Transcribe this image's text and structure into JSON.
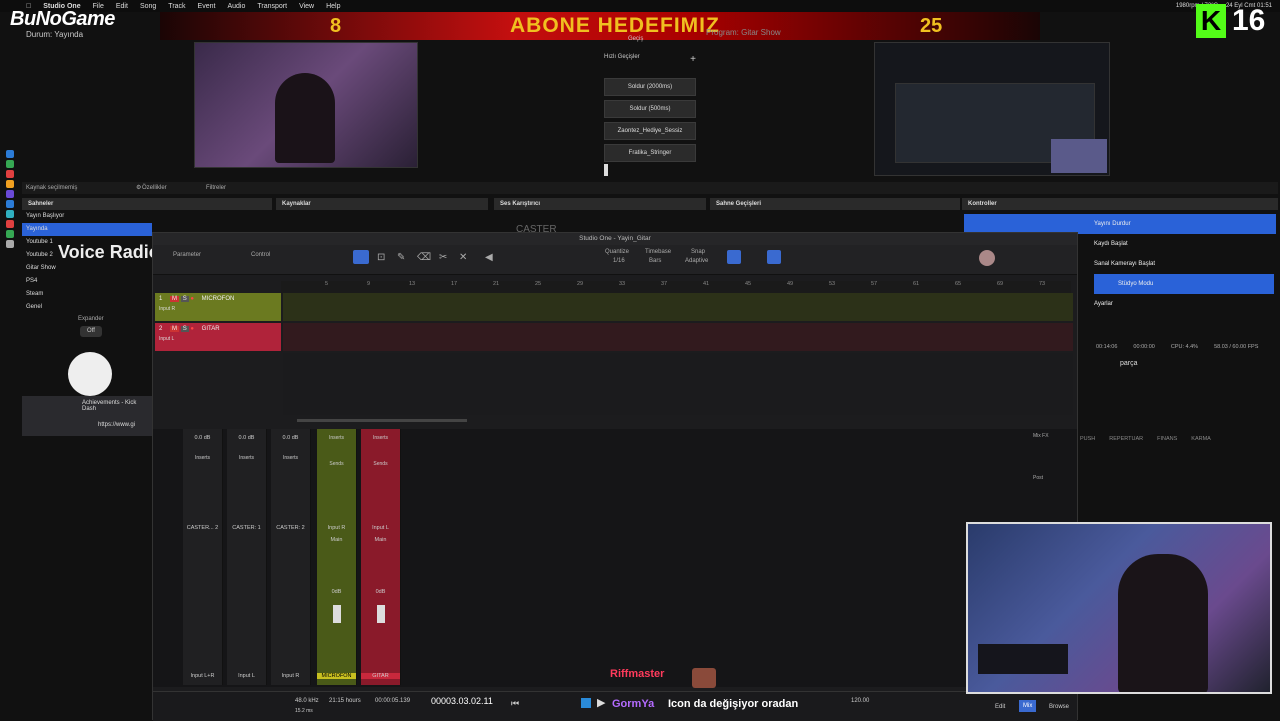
{
  "menubar": {
    "app": "Studio One",
    "items": [
      "File",
      "Edit",
      "Song",
      "Track",
      "Event",
      "Audio",
      "Transport",
      "View",
      "Help"
    ],
    "status_res": "1980rpm / 72°C",
    "date": "24 Eyl Cmt 01:51"
  },
  "logo": {
    "text": "BuNoGame",
    "sub": "Durum: Yayında"
  },
  "banner": {
    "left_num": "8",
    "title": "ABONE HEDEFIMIZ",
    "right_num": "25"
  },
  "kick": {
    "letter": "K",
    "count": "16"
  },
  "program_label": "Program: Gitar Show",
  "transitions": {
    "header": "Geçiş",
    "quick": "Hızlı Geçişler",
    "items": [
      "Soldur (2000ms)",
      "Soldur (500ms)",
      "Zaontez_Hediye_Sessiz",
      "Fratika_Stringer"
    ]
  },
  "obs": {
    "source_bar": "Kaynak seçilmemiş",
    "props": "Özellikler",
    "filters": "Filtreler",
    "docks": [
      "Sahneler",
      "Kaynaklar",
      "Ses Karıştırıcı",
      "Sahne Geçişleri",
      "Kontroller"
    ],
    "scenes": [
      "Yayın Başlıyor",
      "Yayında",
      "Youtube 1",
      "Youtube 2",
      "Gitar Show",
      "PS4",
      "Steam",
      "Genel"
    ],
    "controls": [
      "Yayını Durdur",
      "Kaydı Başlat",
      "Sanal Kamerayı Başlat",
      "Stüdyo Modu",
      "Ayarlar"
    ],
    "stats": {
      "time": "00:14:06",
      "rec": "00:00:00",
      "cpu": "CPU: 4.4%",
      "fps": "58.03 / 60.00 FPS"
    },
    "chat_text": "parça",
    "expander": "Expander",
    "off": "Off"
  },
  "voice_radio": "Voice Radio",
  "caster_label": "CASTER",
  "browser": {
    "tab": "Achievements - Kick Dash",
    "url": "https://www.gi",
    "bookmarks": [
      "PUSH",
      "REPERTUAR",
      "FINANS",
      "KARMA"
    ]
  },
  "studio": {
    "title": "Studio One - Yayin_Gitar",
    "toolbar": {
      "param": "Parameter",
      "control": "Control",
      "quantize": "Quantize",
      "q_val": "1/16",
      "timebase": "Timebase",
      "tb_val": "Bars",
      "snap": "Snap",
      "snap_val": "Adaptive"
    },
    "ruler": [
      "5",
      "9",
      "13",
      "17",
      "21",
      "25",
      "29",
      "33",
      "37",
      "41",
      "45",
      "49",
      "53",
      "57",
      "61",
      "65",
      "69",
      "73"
    ],
    "tracks": [
      {
        "num": "1",
        "name": "MICROFON",
        "input": "Input R",
        "color": "#8a9a2a"
      },
      {
        "num": "2",
        "name": "GITAR",
        "input": "Input L",
        "color": "#c8283c"
      }
    ],
    "mixer": {
      "strips": [
        {
          "name": "CASTER... 2",
          "input": "Input L+R",
          "db": "0.0 dB"
        },
        {
          "name": "CASTER: 1",
          "input": "Input L",
          "db": "0.0 dB"
        },
        {
          "name": "CASTER: 2",
          "input": "Input R",
          "db": "0.0 dB"
        },
        {
          "name": "Input R",
          "input": "MICROFON",
          "db": "0dB",
          "sub": "Main",
          "color": "#8aa32a"
        },
        {
          "name": "Input L",
          "input": "GITAR",
          "db": "0dB",
          "sub": "Main",
          "color": "#c8283c"
        }
      ],
      "inserts": "Inserts",
      "sends": "Sends",
      "post": "Post",
      "mixfx": "Mix FX"
    },
    "transport": {
      "samplerate": "48.0 kHz",
      "latency": "15.2 ms",
      "record_max": "21:15 hours",
      "seconds": "00:00:05.139",
      "bars": "00003.03.02.11",
      "tempo": "120.00",
      "tabs": [
        "Edit",
        "Mix",
        "Browse"
      ]
    }
  },
  "chat": {
    "user1": "Riffmaster",
    "user2": "GormYa",
    "message": "Icon da değişiyor oradan"
  }
}
